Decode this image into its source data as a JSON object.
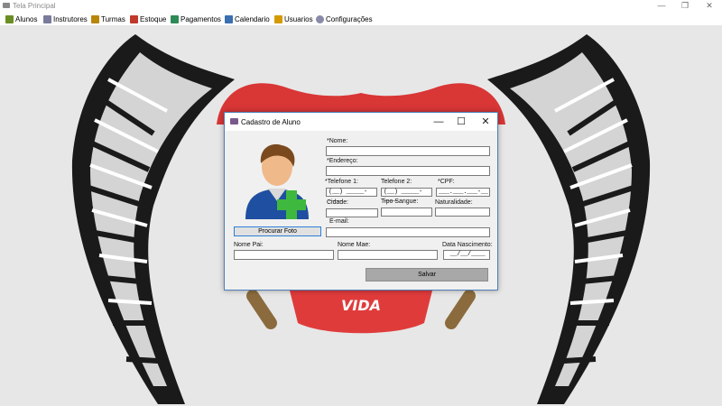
{
  "window": {
    "title": "Tela Principal",
    "minimize": "—",
    "maximize": "❐",
    "close": "✕"
  },
  "menu": [
    {
      "label": "Alunos",
      "icon": "student-icon",
      "color": "#6b8e23"
    },
    {
      "label": "Instrutores",
      "icon": "instructor-icon",
      "color": "#7a7a9a"
    },
    {
      "label": "Turmas",
      "icon": "class-group-icon",
      "color": "#b8860b"
    },
    {
      "label": "Estoque",
      "icon": "inventory-icon",
      "color": "#c0392b"
    },
    {
      "label": "Pagamentos",
      "icon": "payment-icon",
      "color": "#2e8b57"
    },
    {
      "label": "Calendario",
      "icon": "calendar-icon",
      "color": "#3a6fb0"
    },
    {
      "label": "Usuarios",
      "icon": "users-icon",
      "color": "#d49a00"
    },
    {
      "label": "Configurações",
      "icon": "gear-icon",
      "color": "#8a8aa8"
    }
  ],
  "background_logo": {
    "text": "VIDA",
    "accent_color": "#e03b3b"
  },
  "dialog": {
    "title": "Cadastro de Aluno",
    "minimize": "—",
    "maximize": "☐",
    "close": "✕",
    "photo_button": "Procurar Foto",
    "save_button": "Salvar",
    "fields": {
      "nome": {
        "label": "*Nome:",
        "value": ""
      },
      "endereco": {
        "label": "*Endereço:",
        "value": ""
      },
      "telefone1": {
        "label": "*Telefone 1:",
        "mask": "(__) _____-____"
      },
      "telefone2": {
        "label": "Telefone 2:",
        "mask": "(__) _____-____"
      },
      "cpf": {
        "label": "*CPF:",
        "mask": "___.___.___-__"
      },
      "cidade": {
        "label": "Cidade:",
        "value": ""
      },
      "tipo_sangue": {
        "label": "Tipo Sangue:",
        "value": ""
      },
      "naturalidade": {
        "label": "Naturalidade:",
        "value": ""
      },
      "email": {
        "label": "E-mail:",
        "value": ""
      },
      "nome_pai": {
        "label": "Nome Pai:",
        "value": ""
      },
      "nome_mae": {
        "label": "Nome Mae:",
        "value": ""
      },
      "data_nascimento": {
        "label": "Data Nascimento:",
        "mask": "__/__/____"
      }
    }
  }
}
